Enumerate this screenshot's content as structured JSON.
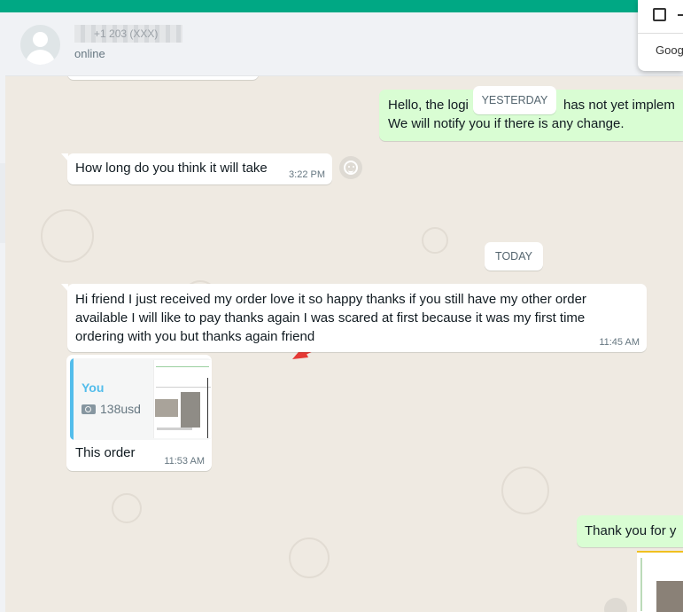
{
  "header": {
    "contact_name": "+1 203 (XXX)",
    "status": "online"
  },
  "popup": {
    "text": "Goog"
  },
  "dates": {
    "yesterday": "YESTERDAY",
    "today": "TODAY"
  },
  "messages": [
    {
      "id": "m1",
      "direction": "outgoing",
      "lines": [
        "Hello, the logi",
        "We will notify you if there is any change."
      ],
      "line1_tail": "has not yet implem"
    },
    {
      "id": "m2",
      "direction": "incoming",
      "text": "How long do you think it will take",
      "time": "3:22 PM"
    },
    {
      "id": "m3",
      "direction": "incoming",
      "lines": [
        "Hi friend I just received my order love it so happy thanks if you still have my other order",
        "available I will like to pay thanks again I was scared at first because it was my first time",
        "ordering with you but thanks again friend"
      ],
      "time": "11:45 AM"
    },
    {
      "id": "m4",
      "direction": "incoming",
      "quoted_author": "You",
      "quoted_caption": "138usd",
      "text": "This order",
      "time": "11:53 AM"
    },
    {
      "id": "m5",
      "direction": "outgoing",
      "text": "Thank you for y"
    }
  ],
  "colors": {
    "header_green": "#00a884",
    "chat_bg": "#efeae2",
    "outgoing_bubble": "#d9fdd3",
    "incoming_bubble": "#ffffff",
    "quote_accent": "#53bdeb",
    "annotation_arrow": "#e53935"
  },
  "icons": [
    "default-avatar-icon",
    "emoji-icon",
    "camera-icon",
    "forward-icon",
    "annotation-arrow-icon"
  ]
}
